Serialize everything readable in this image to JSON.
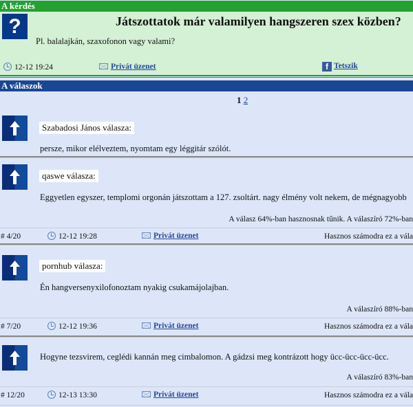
{
  "question": {
    "section_label": "A kérdés",
    "title": "Játszottatok már valamilyen hangszeren szex közben?",
    "body": "Pl. balalajkán, szaxofonon vagy valami?",
    "time": "12-12 19:24",
    "private_message": "Privát üzenet",
    "like": "Tetszik"
  },
  "answers_section": {
    "label": "A válaszok",
    "pages": [
      "1",
      "2"
    ],
    "current_page": "1"
  },
  "answers": [
    {
      "author": "Szabadosi János válasza:",
      "text": "persze, mikor elélveztem, nyomtam egy léggitár szólót."
    },
    {
      "author": "qaswe válasza:",
      "text": "Eggyetlen egyszer, templomi orgonán játszottam a 127. zsoltárt. nagy élmény volt nekem, de mégnagyobb",
      "stats": "A válasz 64%-ban hasznosnak tűnik. A válaszíró 72%-ban",
      "number": "# 4/20",
      "time": "12-12 19:28",
      "private_message": "Privát üzenet",
      "useful": "Hasznos számodra ez a vála"
    },
    {
      "author": "pornhub válasza:",
      "text": "Én hangversenyxilofonoztam nyakig csukamájolajban.",
      "stats": "A válaszíró 88%-ban",
      "number": "# 7/20",
      "time": "12-12 19:36",
      "private_message": "Privát üzenet",
      "useful": "Hasznos számodra ez a vála"
    },
    {
      "text": "Hogyne tezsvirem, ceglédi kannán meg cimbalomon. A gádzsi meg kontrázott hogy ücc-ücc-ücc-ücc.",
      "stats": "A válaszíró 83%-ban",
      "number": "# 12/20",
      "time": "12-13 13:30",
      "private_message": "Privát üzenet",
      "useful": "Hasznos számodra ez a vála"
    }
  ],
  "colors": {
    "question_bar": "#23a131",
    "question_bg": "#d4f0d5",
    "answers_bar": "#1a4793",
    "answers_bg": "#dce6f8"
  }
}
